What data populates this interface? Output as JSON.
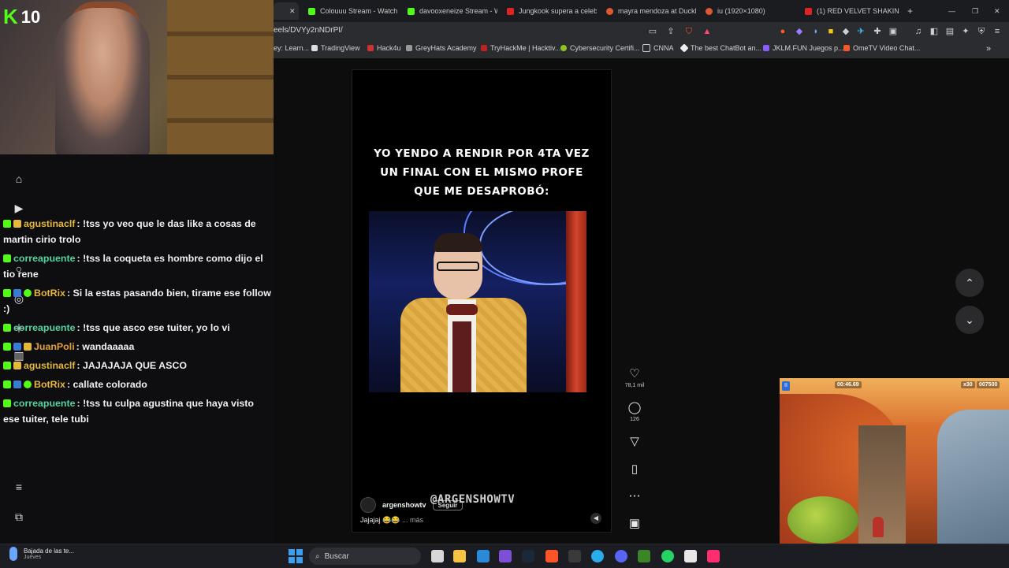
{
  "browser": {
    "tabs": [
      {
        "label": "Colouuu Stream - Watch L",
        "color": "#53fc18"
      },
      {
        "label": "davooxeneize Stream - Wa",
        "color": "#53fc18"
      },
      {
        "label": "Jungkook supera a celebri",
        "color": "#e02424"
      },
      {
        "label": "mayra mendoza at DuckD",
        "color": "#de5833"
      },
      {
        "label": "iu (1920×1080)",
        "color": "#de5833"
      },
      {
        "label": "(1) RED VELVET SHAKING",
        "color": "#e02424"
      }
    ],
    "url": "eels/DVYy2nNDrPI/",
    "bookmarks": [
      "ey: Learn...",
      "TradingView",
      "Hack4u",
      "GreyHats Academy",
      "TryHackMe | Hacktiv...",
      "Cybersecurity Certifi...",
      "CNNA",
      "The best ChatBot an...",
      "JKLM.FUN Juegos p...",
      "OmeTV Video Chat..."
    ]
  },
  "stream": {
    "viewer_count": "10"
  },
  "chat": [
    {
      "user": "agustinaclf",
      "user_color": "#e5b73b",
      "text": ": !tss yo veo que le das like a cosas de martin cirio trolo",
      "badges": [
        "k",
        "sub"
      ]
    },
    {
      "user": "correapuente",
      "user_color": "#53d3a0",
      "text": ": !tss la coqueta es hombre como dijo el tio rene",
      "badges": [
        "k"
      ]
    },
    {
      "user": "BotRix",
      "user_color": "#e5b73b",
      "text": ": Si la estas pasando bien, tirame ese follow :)",
      "badges": [
        "k",
        "mod",
        "ver"
      ]
    },
    {
      "user": "correapuente",
      "user_color": "#53d3a0",
      "text": ": !tss que asco ese tuiter, yo lo vi",
      "badges": [
        "k"
      ]
    },
    {
      "user": "JuanPoli",
      "user_color": "#e5a03b",
      "text": ": wandaaaaa",
      "badges": [
        "k",
        "mod",
        "sub"
      ]
    },
    {
      "user": "agustinaclf",
      "user_color": "#e5b73b",
      "text": ": JAJAJAJA QUE ASCO",
      "badges": [
        "k",
        "sub"
      ]
    },
    {
      "user": "BotRix",
      "user_color": "#e5b73b",
      "text": ": callate colorado",
      "badges": [
        "k",
        "mod",
        "ver"
      ]
    },
    {
      "user": "correapuente",
      "user_color": "#53d3a0",
      "text": ": !tss tu culpa agustina que haya visto ese tuiter, tele tubi",
      "badges": [
        "k"
      ]
    }
  ],
  "reel": {
    "caption_lines": [
      "YO YENDO A RENDIR POR 4TA VEZ",
      "UN FINAL CON EL MISMO PROFE",
      "QUE ME DESAPROBÓ:"
    ],
    "watermark": "@ARGENSHOWTV",
    "author": "argenshowtv",
    "follow_label": "Seguir",
    "description": "Jajajaj 😂😂",
    "more_label": "... más",
    "likes": "78,1 mil",
    "comments": "126"
  },
  "game": {
    "timer": "00:46.69",
    "multiplier": "x30",
    "score": "007500"
  },
  "taskbar": {
    "weather_title": "Bajada de las te...",
    "weather_sub": "Jueves",
    "search_placeholder": "Buscar"
  }
}
